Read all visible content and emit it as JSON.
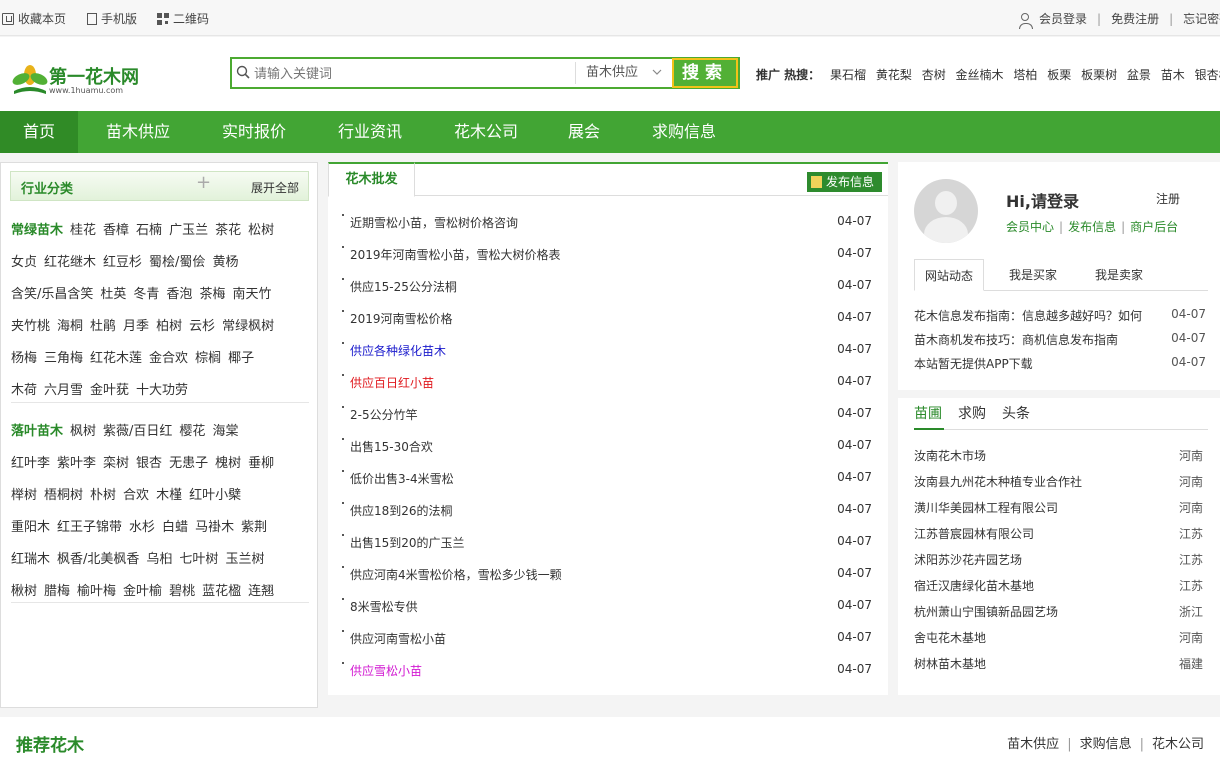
{
  "topbar": {
    "bookmark": "收藏本页",
    "mobile": "手机版",
    "qrcode": "二维码",
    "login": "会员登录",
    "register": "免费注册",
    "forgot": "忘记密码"
  },
  "logo": {
    "name": "第一花木网",
    "url": "www.1huamu.com"
  },
  "search": {
    "placeholder": "请输入关键词",
    "category": "苗木供应",
    "button": "搜索"
  },
  "hot": {
    "label": "推广 热搜：",
    "keywords": [
      "果石榴",
      "黄花梨",
      "杏树",
      "金丝楠木",
      "塔柏",
      "板栗",
      "板栗树",
      "盆景",
      "苗木",
      "银杏树"
    ]
  },
  "nav": [
    "首页",
    "苗木供应",
    "实时报价",
    "行业资讯",
    "花木公司",
    "展会",
    "求购信息"
  ],
  "category": {
    "title": "行业分类",
    "expand": "展开全部",
    "evergreen_title": "常绿苗木",
    "evergreen": [
      [
        "桂花",
        "香樟",
        "石楠",
        "广玉兰",
        "茶花",
        "松树"
      ],
      [
        "女贞",
        "红花继木",
        "红豆杉",
        "蜀桧/蜀侩",
        "黄杨"
      ],
      [
        "含笑/乐昌含笑",
        "杜英",
        "冬青",
        "香泡",
        "茶梅",
        "南天竹"
      ],
      [
        "夹竹桃",
        "海桐",
        "杜鹃",
        "月季",
        "柏树",
        "云杉",
        "常绿枫树"
      ],
      [
        "杨梅",
        "三角梅",
        "红花木莲",
        "金合欢",
        "棕榈",
        "椰子"
      ],
      [
        "木荷",
        "六月雪",
        "金叶莸",
        "十大功劳"
      ]
    ],
    "deciduous_title": "落叶苗木",
    "deciduous": [
      [
        "枫树",
        "紫薇/百日红",
        "樱花",
        "海棠"
      ],
      [
        "红叶李",
        "紫叶李",
        "栾树",
        "银杏",
        "无患子",
        "槐树",
        "垂柳"
      ],
      [
        "榉树",
        "梧桐树",
        "朴树",
        "合欢",
        "木槿",
        "红叶小檗"
      ],
      [
        "重阳木",
        "红王子锦带",
        "水杉",
        "白蜡",
        "马褂木",
        "紫荆"
      ],
      [
        "红瑞木",
        "枫香/北美枫香",
        "乌桕",
        "七叶树",
        "玉兰树"
      ],
      [
        "楸树",
        "腊梅",
        "榆叶梅",
        "金叶榆",
        "碧桃",
        "蓝花楹",
        "连翘"
      ]
    ]
  },
  "wholesale": {
    "tab": "花木批发",
    "publish": "发布信息",
    "items": [
      {
        "title": "近期雪松小苗，雪松树价格咨询",
        "date": "04-07",
        "color": "#333333"
      },
      {
        "title": "2019年河南雪松小苗，雪松大树价格表",
        "date": "04-07",
        "color": "#333333"
      },
      {
        "title": "供应15-25公分法桐",
        "date": "04-07",
        "color": "#333333"
      },
      {
        "title": "2019河南雪松价格",
        "date": "04-07",
        "color": "#333333"
      },
      {
        "title": "供应各种绿化苗木",
        "date": "04-07",
        "color": "#1a1acc"
      },
      {
        "title": "供应百日红小苗",
        "date": "04-07",
        "color": "#e0191e"
      },
      {
        "title": "2-5公分竹竿",
        "date": "04-07",
        "color": "#333333"
      },
      {
        "title": "出售15-30合欢",
        "date": "04-07",
        "color": "#333333"
      },
      {
        "title": "低价出售3-4米雪松",
        "date": "04-07",
        "color": "#333333"
      },
      {
        "title": "供应18到26的法桐",
        "date": "04-07",
        "color": "#333333"
      },
      {
        "title": "出售15到20的广玉兰",
        "date": "04-07",
        "color": "#333333"
      },
      {
        "title": "供应河南4米雪松价格，雪松多少钱一颗",
        "date": "04-07",
        "color": "#333333"
      },
      {
        "title": "8米雪松专供",
        "date": "04-07",
        "color": "#333333"
      },
      {
        "title": "供应河南雪松小苗",
        "date": "04-07",
        "color": "#333333"
      },
      {
        "title": "供应雪松小苗",
        "date": "04-07",
        "color": "#d21ad2"
      }
    ]
  },
  "user": {
    "greeting": "Hi,请登录",
    "register": "注册",
    "links": [
      "会员中心",
      "发布信息",
      "商户后台"
    ],
    "tabs": [
      "网站动态",
      "我是买家",
      "我是卖家"
    ],
    "news": [
      {
        "title": "花木信息发布指南：信息越多越好吗？如何",
        "date": "04-07"
      },
      {
        "title": "苗木商机发布技巧：商机信息发布指南",
        "date": "04-07"
      },
      {
        "title": "本站暂无提供APP下载",
        "date": "04-07"
      }
    ]
  },
  "gardens": {
    "tabs": [
      "苗圃",
      "求购",
      "头条"
    ],
    "items": [
      {
        "name": "汝南花木市场",
        "province": "河南"
      },
      {
        "name": "汝南县九州花木种植专业合作社",
        "province": "河南"
      },
      {
        "name": "潢川华美园林工程有限公司",
        "province": "河南"
      },
      {
        "name": "江苏普宸园林有限公司",
        "province": "江苏"
      },
      {
        "name": "沭阳苏沙花卉园艺场",
        "province": "江苏"
      },
      {
        "name": "宿迁汉唐绿化苗木基地",
        "province": "江苏"
      },
      {
        "name": "杭州萧山宁围镇新品园艺场",
        "province": "浙江"
      },
      {
        "name": "舍屯花木基地",
        "province": "河南"
      },
      {
        "name": "树林苗木基地",
        "province": "福建"
      }
    ]
  },
  "bottom": {
    "title": "推荐花木",
    "links": [
      "苗木供应",
      "求购信息",
      "花木公司"
    ]
  },
  "colors": {
    "brand_green": "#42a534",
    "nav_active": "#308b26"
  }
}
